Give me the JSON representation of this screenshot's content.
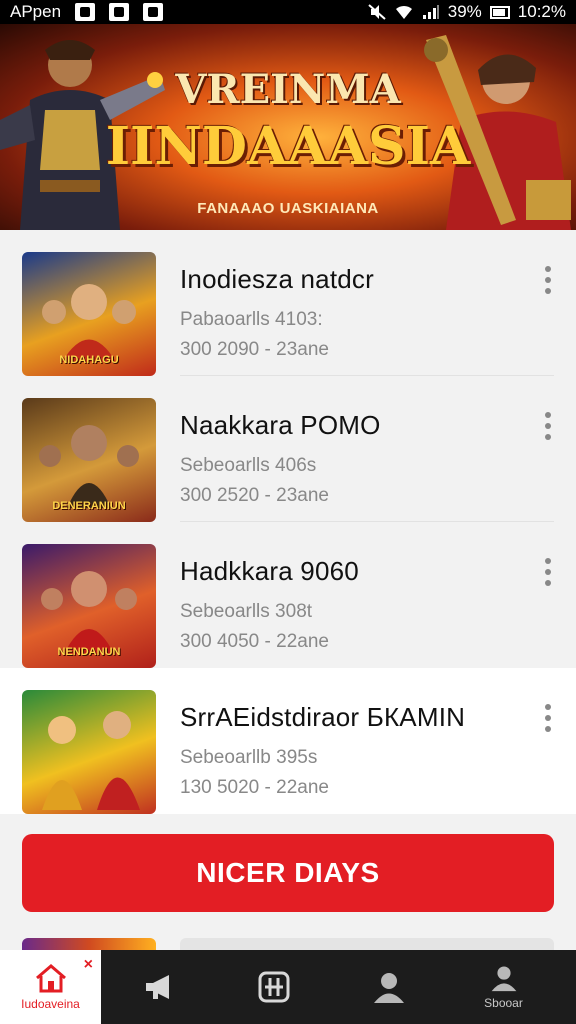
{
  "status_bar": {
    "app_name": "APpen",
    "battery": "39%",
    "time": "10:2%"
  },
  "banner": {
    "title_line1": "VREINMA",
    "title_line2": "IINDAAASIA",
    "subtitle": "FANAAAO UASKIAIANA"
  },
  "games": [
    {
      "title": "Inodiesza natdcr",
      "meta1": "Pabaoarlls 4103:",
      "meta2": "300 2090 - 23ane",
      "thumb_caption": "NIDAHAGU",
      "colors": [
        "#1a3a8a",
        "#e8a020",
        "#c02a1a"
      ]
    },
    {
      "title": "Naakkara POMO",
      "meta1": "Sebeoarlls 406s",
      "meta2": "300 2520 - 23ane",
      "thumb_caption": "DENERANIUN",
      "colors": [
        "#5a3a1a",
        "#d49a3a",
        "#8a2a1a"
      ]
    },
    {
      "title": "Hadkkara 9060",
      "meta1": "Sebeoarlls 308t",
      "meta2": "300 4050 - 22ane",
      "thumb_caption": "NENDANUN",
      "colors": [
        "#3a1a6a",
        "#e0602a",
        "#b0201a"
      ]
    },
    {
      "title": "SrrAEidstdiraor БКАMIN",
      "meta1": "Sebeoarllb 395s",
      "meta2": "130 5020 - 22ane",
      "thumb_caption": "",
      "colors": [
        "#2a8a3a",
        "#f0c020",
        "#c03020"
      ]
    }
  ],
  "cta_label": "NICER DIAYS",
  "bottom_nav": {
    "items": [
      {
        "label": "Iudoaveina",
        "icon": "home-icon",
        "active": true
      },
      {
        "label": "",
        "icon": "megaphone-icon",
        "active": false
      },
      {
        "label": "",
        "icon": "grid-box-icon",
        "active": false
      },
      {
        "label": "",
        "icon": "person-icon",
        "active": false
      },
      {
        "label": "Sbooar",
        "icon": "person-icon",
        "active": false
      }
    ],
    "badge": "×"
  },
  "accent_color": "#e31e24"
}
